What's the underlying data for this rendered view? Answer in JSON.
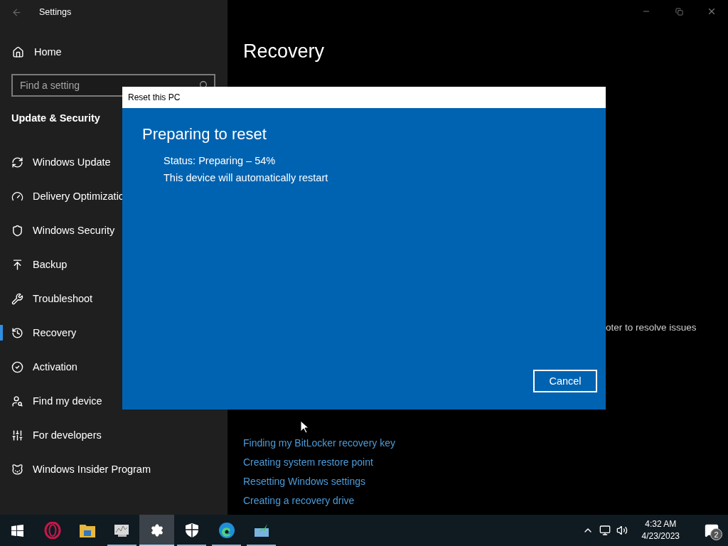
{
  "window": {
    "title": "Settings"
  },
  "sidebar": {
    "home": "Home",
    "search": {
      "placeholder": "Find a setting"
    },
    "section": "Update & Security",
    "items": [
      {
        "label": "Windows Update",
        "selected": false
      },
      {
        "label": "Delivery Optimizatio",
        "selected": false
      },
      {
        "label": "Windows Security",
        "selected": false
      },
      {
        "label": "Backup",
        "selected": false
      },
      {
        "label": "Troubleshoot",
        "selected": false
      },
      {
        "label": "Recovery",
        "selected": true
      },
      {
        "label": "Activation",
        "selected": false
      },
      {
        "label": "Find my device",
        "selected": false
      },
      {
        "label": "For developers",
        "selected": false
      },
      {
        "label": "Windows Insider Program",
        "selected": false
      }
    ]
  },
  "content": {
    "heading": "Recovery",
    "snippet": "oter to resolve issues",
    "links": [
      "Finding my BitLocker recovery key",
      "Creating system restore point",
      "Resetting Windows settings",
      "Creating a recovery drive"
    ]
  },
  "dialog": {
    "title": "Reset this PC",
    "heading": "Preparing to reset",
    "lines": [
      "Status: Preparing – 54%",
      "This device will automatically restart"
    ],
    "button": "Cancel"
  },
  "taskbar": {
    "apps": [
      {
        "kind": "start",
        "selected": false,
        "running": false
      },
      {
        "kind": "browser-ring",
        "selected": false,
        "running": false
      },
      {
        "kind": "folder",
        "selected": false,
        "running": false
      },
      {
        "kind": "monitor-app",
        "selected": false,
        "running": true
      },
      {
        "kind": "settings",
        "selected": true,
        "running": true
      },
      {
        "kind": "shield",
        "selected": false,
        "running": true
      },
      {
        "kind": "edge",
        "selected": false,
        "running": true
      },
      {
        "kind": "installer",
        "selected": false,
        "running": true
      }
    ],
    "time": "4:32 AM",
    "date": "4/23/2023",
    "notifications": "2"
  }
}
